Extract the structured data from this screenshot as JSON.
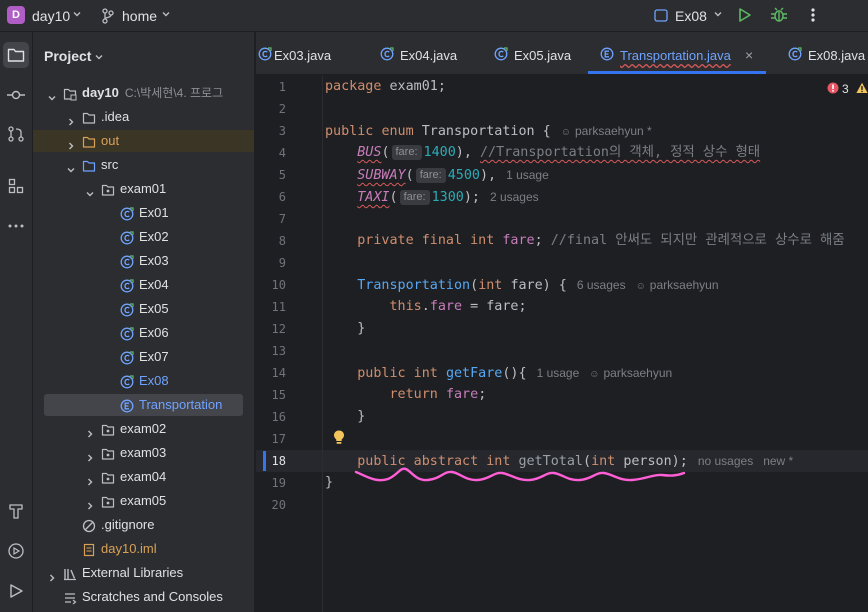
{
  "titlebar": {
    "project_badge": "D",
    "project_name": "day10",
    "branch": "home",
    "run_config": "Ex08"
  },
  "project_panel": {
    "title": "Project",
    "tree": [
      {
        "label": "day10",
        "path": "C:\\박세현\\4. 프로그",
        "kind": "module",
        "expanded": true
      },
      {
        "label": ".idea",
        "kind": "folder",
        "expanded": false
      },
      {
        "label": "out",
        "kind": "folder-excluded",
        "expanded": false
      },
      {
        "label": "src",
        "kind": "source-folder",
        "expanded": true
      },
      {
        "label": "exam01",
        "kind": "package",
        "expanded": true
      },
      {
        "label": "Ex01",
        "kind": "class"
      },
      {
        "label": "Ex02",
        "kind": "class"
      },
      {
        "label": "Ex03",
        "kind": "class"
      },
      {
        "label": "Ex04",
        "kind": "class"
      },
      {
        "label": "Ex05",
        "kind": "class"
      },
      {
        "label": "Ex06",
        "kind": "class"
      },
      {
        "label": "Ex07",
        "kind": "class"
      },
      {
        "label": "Ex08",
        "kind": "class"
      },
      {
        "label": "Transportation",
        "kind": "enum",
        "selected": true
      },
      {
        "label": "exam02",
        "kind": "package",
        "expanded": false
      },
      {
        "label": "exam03",
        "kind": "package",
        "expanded": false
      },
      {
        "label": "exam04",
        "kind": "package",
        "expanded": false
      },
      {
        "label": "exam05",
        "kind": "package",
        "expanded": false
      },
      {
        "label": ".gitignore",
        "kind": "ignore-file"
      },
      {
        "label": "day10.iml",
        "kind": "iml-file"
      },
      {
        "label": "External Libraries",
        "kind": "libraries",
        "expanded": false
      },
      {
        "label": "Scratches and Consoles",
        "kind": "scratches"
      }
    ]
  },
  "tabs": [
    {
      "label": "Ex03.java",
      "kind": "class"
    },
    {
      "label": "Ex04.java",
      "kind": "class"
    },
    {
      "label": "Ex05.java",
      "kind": "class"
    },
    {
      "label": "Transportation.java",
      "kind": "enum",
      "active": true,
      "close": "×"
    },
    {
      "label": "Ex08.java",
      "kind": "class"
    }
  ],
  "editor": {
    "error_count": "3",
    "current_line": 18,
    "line_numbers": [
      "1",
      "2",
      "3",
      "4",
      "5",
      "6",
      "7",
      "8",
      "9",
      "10",
      "11",
      "12",
      "13",
      "14",
      "15",
      "16",
      "17",
      "18",
      "19",
      "20"
    ],
    "code": {
      "l1_kw": "package",
      "l1_rest": " exam01;",
      "l3_kw1": "public",
      "l3_kw2": "enum",
      "l3_name": "Transportation {",
      "l3_author": "parksaehyun *",
      "l4_const": "BUS",
      "l4_hint": "fare:",
      "l4_num": "1400",
      "l4_comment": "//Transportation의 객체, 정적 상수 형태",
      "l5_const": "SUBWAY",
      "l5_hint": "fare:",
      "l5_num": "4500",
      "l5_usage": "1 usage",
      "l6_const": "TAXI",
      "l6_hint": "fare:",
      "l6_num": "1300",
      "l6_usage": "2 usages",
      "l8_kw": "private final int",
      "l8_field": "fare",
      "l8_comment": "//final 안써도 되지만 관례적으로 상수로 해줌",
      "l10_name": "Transportation",
      "l10_kw": "int",
      "l10_param": "fare) {",
      "l10_usage": "6 usages",
      "l10_author": "parksaehyun",
      "l11_kw": "this",
      "l11_field": "fare",
      "l11_rest": " = fare;",
      "l12": "}",
      "l14_kw": "public int",
      "l14_method": "getFare",
      "l14_rest": "(){",
      "l14_usage": "1 usage",
      "l14_author": "parksaehyun",
      "l15_kw": "return",
      "l15_field": "fare",
      "l16": "}",
      "l18_kw": "public abstract int",
      "l18_method": "getTotal",
      "l18_kw2": "int",
      "l18_param": "person);",
      "l18_usage": "no usages",
      "l18_author": "new *",
      "l19": "}"
    }
  },
  "colors": {
    "accent": "#3574f0",
    "keyword": "#cf8e6d",
    "constant": "#c77dbb",
    "number": "#2aacb8",
    "method": "#56a8f5",
    "annotation_pen": "#ff5fd6"
  },
  "icons": [
    "app-menu-icon",
    "branch-icon",
    "run-icon",
    "debug-icon",
    "more-icon",
    "folder-icon",
    "commit-icon",
    "pull-request-icon",
    "structure-icon",
    "bulb-icon",
    "error-icon",
    "warning-icon"
  ]
}
